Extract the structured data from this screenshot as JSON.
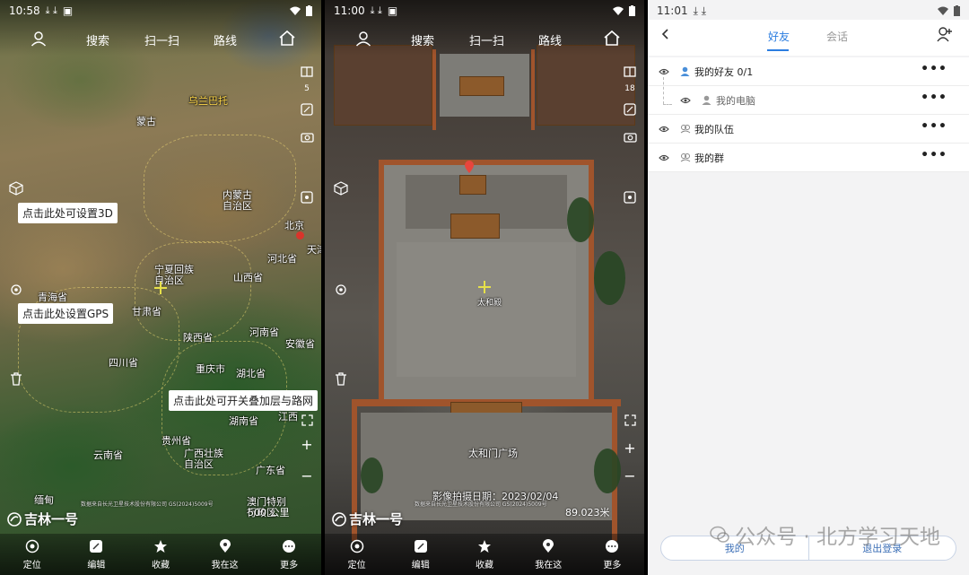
{
  "screen1": {
    "status": {
      "time": "10:58"
    },
    "nav": {
      "search": "搜索",
      "scan": "扫一扫",
      "route": "路线"
    },
    "layer_count": "5",
    "tips": {
      "set3d": "点击此处可设置3D",
      "setgps": "点击此处设置GPS",
      "overlay": "点击此处可开关叠加层与路网"
    },
    "places": [
      {
        "name": "乌兰巴托",
        "style": "y"
      },
      {
        "name": "蒙古"
      },
      {
        "name": "内蒙古\n自治区"
      },
      {
        "name": "北京"
      },
      {
        "name": "天津"
      },
      {
        "name": "河北省"
      },
      {
        "name": "宁夏回族\n自治区"
      },
      {
        "name": "山西省"
      },
      {
        "name": "青海省"
      },
      {
        "name": "甘肃省"
      },
      {
        "name": "陕西省"
      },
      {
        "name": "河南省"
      },
      {
        "name": "安徽省"
      },
      {
        "name": "四川省"
      },
      {
        "name": "重庆市"
      },
      {
        "name": "湖北省"
      },
      {
        "name": "湖南省"
      },
      {
        "name": "江西"
      },
      {
        "name": "贵州省"
      },
      {
        "name": "云南省"
      },
      {
        "name": "广西壮族\n自治区"
      },
      {
        "name": "广东省"
      },
      {
        "name": "澳门特别\n行政区"
      },
      {
        "name": "缅甸"
      }
    ],
    "logo": "吉林一号",
    "credit": "数据来自长光卫星技术股份有限公司 GS(2024)5009号",
    "scale": "500 公里"
  },
  "screen2": {
    "status": {
      "time": "11:00"
    },
    "nav": {
      "search": "搜索",
      "scan": "扫一扫",
      "route": "路线"
    },
    "layer_count": "18",
    "places": [
      {
        "name": "太和殿"
      },
      {
        "name": "太和门广场"
      }
    ],
    "date_label": "影像拍摄日期：2023/02/04",
    "logo": "吉林一号",
    "credit": "数据来自长光卫星技术股份有限公司 GS(2024)5009号",
    "scale": "89.023米"
  },
  "bottom_nav": [
    "定位",
    "编辑",
    "收藏",
    "我在这",
    "更多"
  ],
  "screen3": {
    "status": {
      "time": "11:01"
    },
    "tabs": {
      "friends": "好友",
      "chat": "会话"
    },
    "rows": {
      "friends": "我的好友 0/1",
      "pc": "我的电脑",
      "team": "我的队伍",
      "group": "我的群"
    },
    "more": "•••",
    "bottom": {
      "mine": "我的",
      "logout": "退出登录"
    },
    "watermark": "公众号 · 北方学习天地"
  },
  "colors": {
    "accent": "#2b7de0",
    "tip_bg": "#ffffff",
    "label_yellow": "#ffd84a"
  },
  "icons": [
    "user-icon",
    "home-icon",
    "layers-icon",
    "screenshot-icon",
    "camera-icon",
    "cube-3d-icon",
    "gps-icon",
    "trash-icon",
    "compass-icon",
    "locate-icon",
    "edit-icon",
    "star-icon",
    "pin-icon",
    "more-icon",
    "back-icon",
    "add-user-icon",
    "eye-icon",
    "person-icon",
    "group-icon",
    "wifi-icon",
    "battery-icon",
    "download-icon"
  ]
}
